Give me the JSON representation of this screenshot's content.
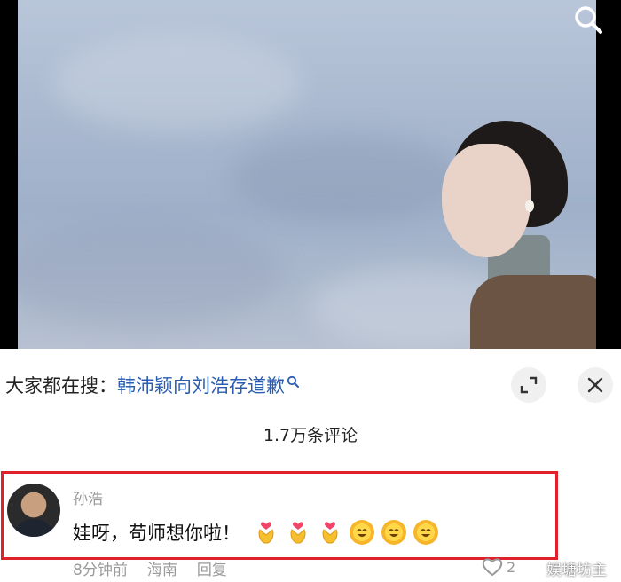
{
  "photo": {
    "description_icon": "search-icon"
  },
  "hot_search": {
    "prefix": "大家都在搜：",
    "query": "韩沛颖向刘浩存道歉"
  },
  "comments": {
    "count_label": "1.7万条评论"
  },
  "comment": {
    "username": "孙浩",
    "text": "娃呀，苟师想你啦！",
    "emojis": [
      "heart-hands-emoji",
      "heart-hands-emoji",
      "heart-hands-emoji",
      "sun-smile-emoji",
      "sun-smile-emoji",
      "sun-smile-emoji"
    ],
    "time": "8分钟前",
    "location": "海南",
    "reply_label": "回复",
    "like_count": "2"
  },
  "watermark": {
    "text": "娱塘坊主"
  },
  "colors": {
    "link": "#2a5db0",
    "highlight": "#e0202a",
    "secondary_text": "#9a9a9a"
  }
}
